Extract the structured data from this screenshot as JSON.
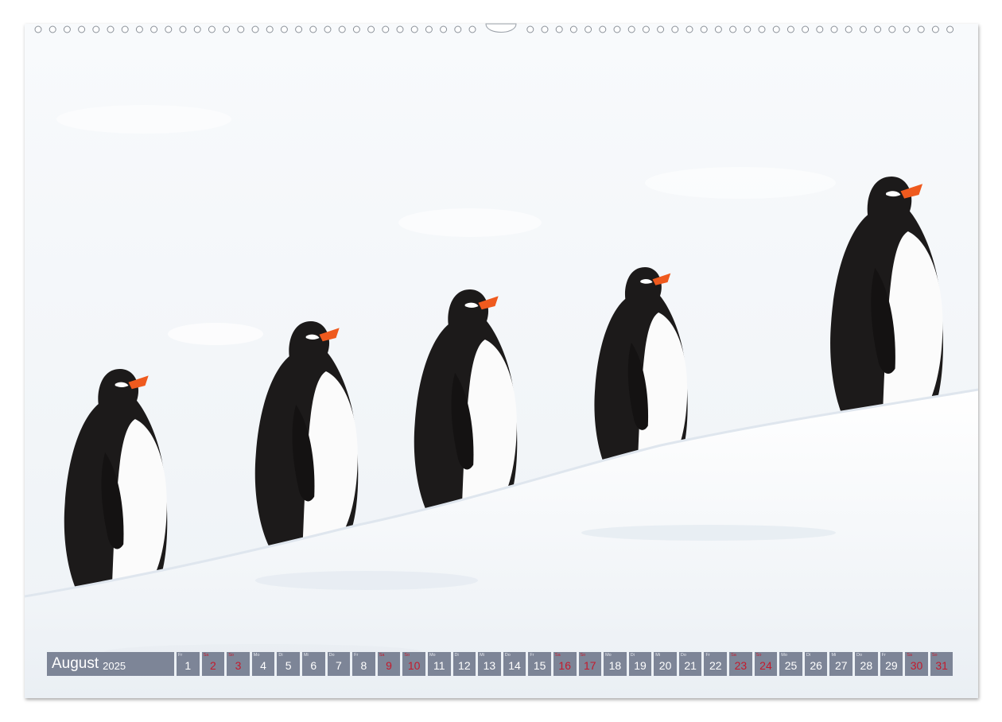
{
  "calendar": {
    "month": "August",
    "year": "2025",
    "days": [
      {
        "num": "1",
        "wd": "Fr",
        "weekend": false
      },
      {
        "num": "2",
        "wd": "Sa",
        "weekend": true
      },
      {
        "num": "3",
        "wd": "So",
        "weekend": true
      },
      {
        "num": "4",
        "wd": "Mo",
        "weekend": false
      },
      {
        "num": "5",
        "wd": "Di",
        "weekend": false
      },
      {
        "num": "6",
        "wd": "Mi",
        "weekend": false
      },
      {
        "num": "7",
        "wd": "Do",
        "weekend": false
      },
      {
        "num": "8",
        "wd": "Fr",
        "weekend": false
      },
      {
        "num": "9",
        "wd": "Sa",
        "weekend": true
      },
      {
        "num": "10",
        "wd": "So",
        "weekend": true
      },
      {
        "num": "11",
        "wd": "Mo",
        "weekend": false
      },
      {
        "num": "12",
        "wd": "Di",
        "weekend": false
      },
      {
        "num": "13",
        "wd": "Mi",
        "weekend": false
      },
      {
        "num": "14",
        "wd": "Do",
        "weekend": false
      },
      {
        "num": "15",
        "wd": "Fr",
        "weekend": false
      },
      {
        "num": "16",
        "wd": "Sa",
        "weekend": true
      },
      {
        "num": "17",
        "wd": "So",
        "weekend": true
      },
      {
        "num": "18",
        "wd": "Mo",
        "weekend": false
      },
      {
        "num": "19",
        "wd": "Di",
        "weekend": false
      },
      {
        "num": "20",
        "wd": "Mi",
        "weekend": false
      },
      {
        "num": "21",
        "wd": "Do",
        "weekend": false
      },
      {
        "num": "22",
        "wd": "Fr",
        "weekend": false
      },
      {
        "num": "23",
        "wd": "Sa",
        "weekend": true
      },
      {
        "num": "24",
        "wd": "So",
        "weekend": true
      },
      {
        "num": "25",
        "wd": "Mo",
        "weekend": false
      },
      {
        "num": "26",
        "wd": "Di",
        "weekend": false
      },
      {
        "num": "27",
        "wd": "Mi",
        "weekend": false
      },
      {
        "num": "28",
        "wd": "Do",
        "weekend": false
      },
      {
        "num": "29",
        "wd": "Fr",
        "weekend": false
      },
      {
        "num": "30",
        "wd": "Sa",
        "weekend": true
      },
      {
        "num": "31",
        "wd": "So",
        "weekend": true
      }
    ]
  },
  "colors": {
    "bar": "#7d8597",
    "weekend": "#c41a2c",
    "snow": "#f4f7fa",
    "beak": "#ef5a1e"
  },
  "icons": {
    "binding": "spiral-binding-icon",
    "penguin": "penguin-icon"
  }
}
